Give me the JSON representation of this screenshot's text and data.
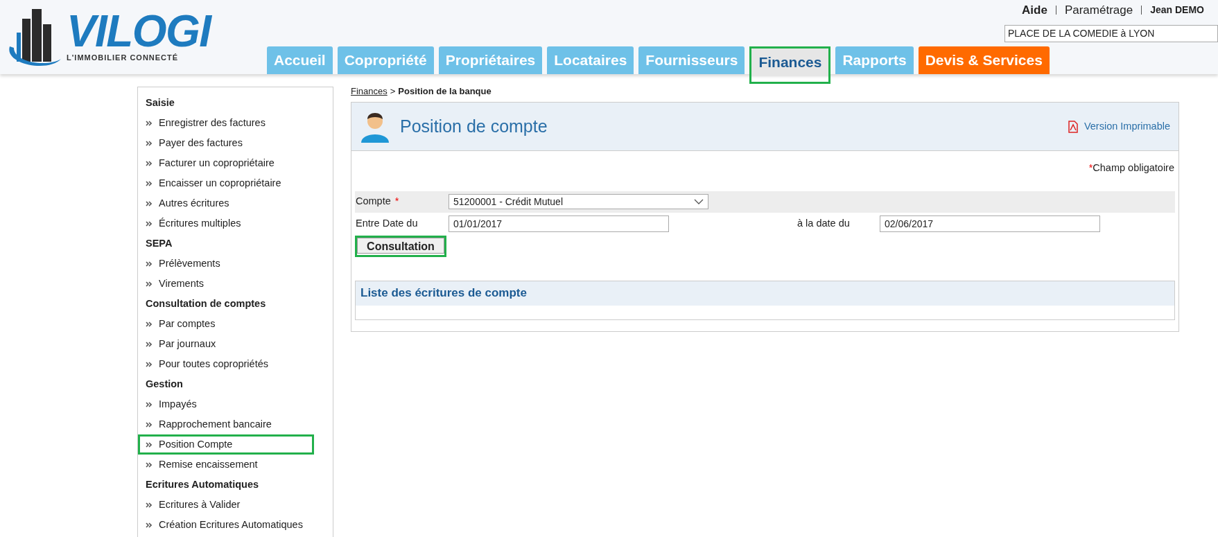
{
  "header": {
    "logo": {
      "name": "VILOGI",
      "tagline": "L'IMMOBILIER CONNECTÉ"
    },
    "top_links": [
      "Aide",
      "Paramétrage",
      "Jean DEMO"
    ],
    "property_select": {
      "value": "PLACE DE LA COMEDIE à LYON"
    },
    "tabs": [
      {
        "label": "Accueil",
        "selected": false,
        "kind": "normal",
        "highlighted": false
      },
      {
        "label": "Copropriété",
        "selected": false,
        "kind": "normal",
        "highlighted": false
      },
      {
        "label": "Propriétaires",
        "selected": false,
        "kind": "normal",
        "highlighted": false
      },
      {
        "label": "Locataires",
        "selected": false,
        "kind": "normal",
        "highlighted": false
      },
      {
        "label": "Fournisseurs",
        "selected": false,
        "kind": "normal",
        "highlighted": false
      },
      {
        "label": "Finances",
        "selected": true,
        "kind": "normal",
        "highlighted": true
      },
      {
        "label": "Rapports",
        "selected": false,
        "kind": "normal",
        "highlighted": false
      },
      {
        "label": "Devis & Services",
        "selected": false,
        "kind": "accent",
        "highlighted": false
      }
    ]
  },
  "sidebar": {
    "sections": [
      {
        "title": "Saisie",
        "items": [
          {
            "label": "Enregistrer des factures",
            "highlighted": false
          },
          {
            "label": "Payer des factures",
            "highlighted": false
          },
          {
            "label": "Facturer un copropriétaire",
            "highlighted": false
          },
          {
            "label": "Encaisser un copropriétaire",
            "highlighted": false
          },
          {
            "label": "Autres écritures",
            "highlighted": false
          },
          {
            "label": "Écritures multiples",
            "highlighted": false
          }
        ]
      },
      {
        "title": "SEPA",
        "items": [
          {
            "label": "Prélèvements",
            "highlighted": false
          },
          {
            "label": "Virements",
            "highlighted": false
          }
        ]
      },
      {
        "title": "Consultation de comptes",
        "items": [
          {
            "label": "Par comptes",
            "highlighted": false
          },
          {
            "label": "Par journaux",
            "highlighted": false
          },
          {
            "label": "Pour toutes copropriétés",
            "highlighted": false
          }
        ]
      },
      {
        "title": "Gestion",
        "items": [
          {
            "label": "Impayés",
            "highlighted": false
          },
          {
            "label": "Rapprochement bancaire",
            "highlighted": false
          },
          {
            "label": "Position Compte",
            "highlighted": true
          },
          {
            "label": "Remise encaissement",
            "highlighted": false
          }
        ]
      },
      {
        "title": "Ecritures Automatiques",
        "items": [
          {
            "label": "Ecritures à Valider",
            "highlighted": false
          },
          {
            "label": "Création Ecritures Automatiques",
            "highlighted": false
          }
        ]
      }
    ]
  },
  "breadcrumb": {
    "link": "Finances",
    "separator": ">",
    "current": "Position de la banque"
  },
  "panel": {
    "title": "Position de compte",
    "print_link": "Version Imprimable",
    "required_note": {
      "mark": "*",
      "text": "Champ obligatoire"
    },
    "form": {
      "account": {
        "label": "Compte",
        "mark": "*",
        "value": "51200001 - Crédit Mutuel"
      },
      "date_from": {
        "label": "Entre Date du",
        "value": "01/01/2017"
      },
      "date_to": {
        "label": "à la date du",
        "value": "02/06/2017"
      },
      "submit": {
        "label": "Consultation",
        "highlighted": true
      }
    },
    "entries": {
      "title": "Liste des écritures de compte"
    }
  }
}
